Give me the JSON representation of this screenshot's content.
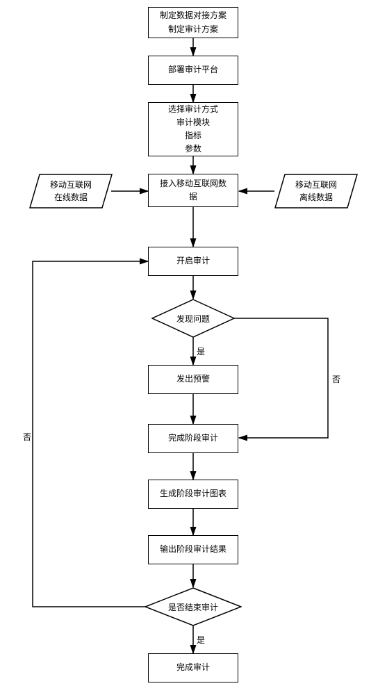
{
  "chart_data": {
    "type": "flowchart",
    "nodes": [
      {
        "id": "n1",
        "kind": "process",
        "lines": [
          "制定数据对接方案",
          "制定审计方案"
        ]
      },
      {
        "id": "n2",
        "kind": "process",
        "lines": [
          "部署审计平台"
        ]
      },
      {
        "id": "n3",
        "kind": "process",
        "lines": [
          "选择审计方式",
          "审计模块",
          "指标",
          "参数"
        ]
      },
      {
        "id": "n4",
        "kind": "process",
        "lines": [
          "接入移动互联网数",
          "据"
        ]
      },
      {
        "id": "n4l",
        "kind": "io",
        "lines": [
          "移动互联网",
          "在线数据"
        ]
      },
      {
        "id": "n4r",
        "kind": "io",
        "lines": [
          "移动互联网",
          "离线数据"
        ]
      },
      {
        "id": "n5",
        "kind": "process",
        "lines": [
          "开启审计"
        ]
      },
      {
        "id": "d1",
        "kind": "decision",
        "lines": [
          "发现问题"
        ]
      },
      {
        "id": "n6",
        "kind": "process",
        "lines": [
          "发出预警"
        ]
      },
      {
        "id": "n7",
        "kind": "process",
        "lines": [
          "完成阶段审计"
        ]
      },
      {
        "id": "n8",
        "kind": "process",
        "lines": [
          "生成阶段审计图表"
        ]
      },
      {
        "id": "n9",
        "kind": "process",
        "lines": [
          "输出阶段审计结果"
        ]
      },
      {
        "id": "d2",
        "kind": "decision",
        "lines": [
          "是否结束审计"
        ]
      },
      {
        "id": "n10",
        "kind": "process",
        "lines": [
          "完成审计"
        ]
      }
    ],
    "edges": [
      {
        "from": "n1",
        "to": "n2"
      },
      {
        "from": "n2",
        "to": "n3"
      },
      {
        "from": "n3",
        "to": "n4"
      },
      {
        "from": "n4l",
        "to": "n4"
      },
      {
        "from": "n4r",
        "to": "n4"
      },
      {
        "from": "n4",
        "to": "n5"
      },
      {
        "from": "n5",
        "to": "d1"
      },
      {
        "from": "d1",
        "to": "n6",
        "label": "是"
      },
      {
        "from": "d1",
        "to": "n7",
        "label": "否",
        "route": "right"
      },
      {
        "from": "n6",
        "to": "n7"
      },
      {
        "from": "n7",
        "to": "n8"
      },
      {
        "from": "n8",
        "to": "n9"
      },
      {
        "from": "n9",
        "to": "d2"
      },
      {
        "from": "d2",
        "to": "n10",
        "label": "是"
      },
      {
        "from": "d2",
        "to": "n5",
        "label": "否",
        "route": "left"
      }
    ]
  },
  "labels": {
    "yes": "是",
    "no": "否"
  },
  "n1_l1": "制定数据对接方案",
  "n1_l2": "制定审计方案",
  "n2_l1": "部署审计平台",
  "n3_l1": "选择审计方式",
  "n3_l2": "审计模块",
  "n3_l3": "指标",
  "n3_l4": "参数",
  "n4_l1": "接入移动互联网数",
  "n4_l2": "据",
  "n4l_l1": "移动互联网",
  "n4l_l2": "在线数据",
  "n4r_l1": "移动互联网",
  "n4r_l2": "离线数据",
  "n5_l1": "开启审计",
  "d1_l1": "发现问题",
  "n6_l1": "发出预警",
  "n7_l1": "完成阶段审计",
  "n8_l1": "生成阶段审计图表",
  "n9_l1": "输出阶段审计结果",
  "d2_l1": "是否结束审计",
  "n10_l1": "完成审计"
}
